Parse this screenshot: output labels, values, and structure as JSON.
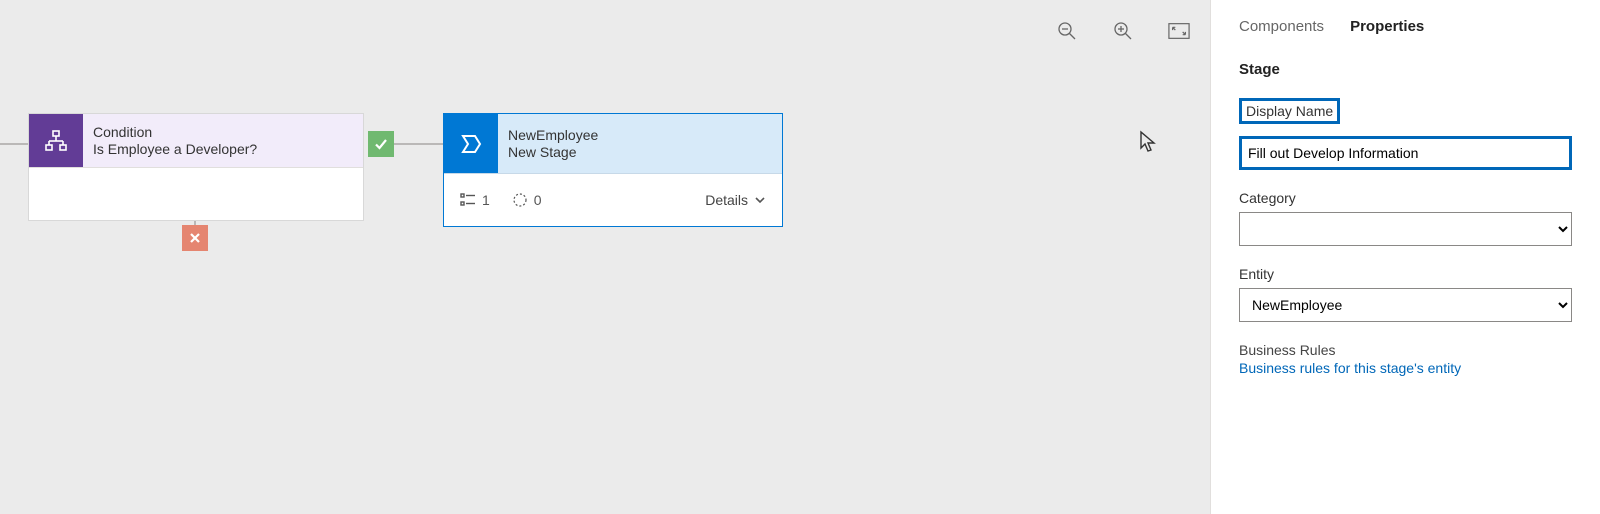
{
  "canvas": {
    "condition": {
      "type_label": "Condition",
      "name": "Is Employee a Developer?"
    },
    "stage": {
      "entity_label": "NewEmployee",
      "stage_label": "New Stage",
      "step_count": "1",
      "flow_count": "0",
      "details_label": "Details"
    }
  },
  "panel": {
    "tabs": {
      "components": "Components",
      "properties": "Properties"
    },
    "section_title": "Stage",
    "display_name": {
      "label": "Display Name",
      "value": "Fill out Develop Information"
    },
    "category": {
      "label": "Category",
      "value": ""
    },
    "entity": {
      "label": "Entity",
      "value": "NewEmployee"
    },
    "business_rules": {
      "label": "Business Rules",
      "link": "Business rules for this stage's entity"
    }
  }
}
